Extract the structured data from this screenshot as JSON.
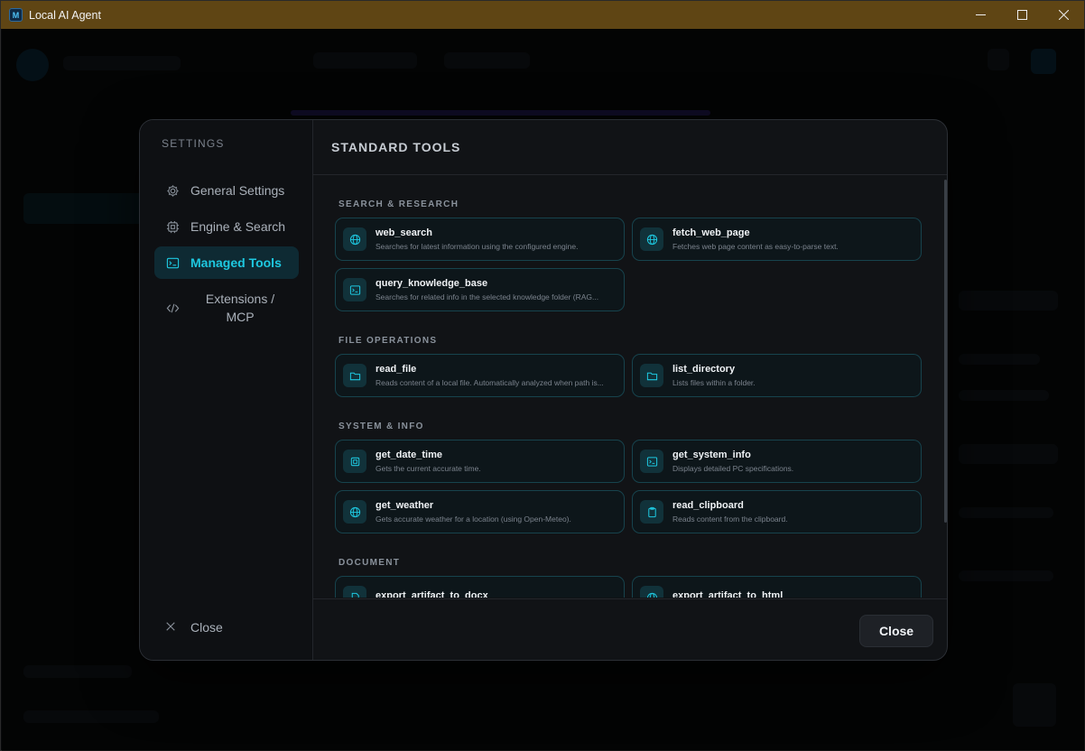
{
  "window": {
    "title": "Local AI Agent",
    "icon_letter": "M"
  },
  "sidebar": {
    "title": "SETTINGS",
    "items": [
      {
        "label": "General Settings",
        "icon": "gear-icon"
      },
      {
        "label": "Engine & Search",
        "icon": "chip-icon"
      },
      {
        "label": "Managed Tools",
        "icon": "terminal-icon"
      },
      {
        "label": "Extensions / MCP",
        "icon": "code-icon"
      }
    ],
    "close_label": "Close"
  },
  "main": {
    "title": "STANDARD TOOLS",
    "sections": [
      {
        "label": "SEARCH & RESEARCH"
      },
      {
        "label": "FILE OPERATIONS"
      },
      {
        "label": "SYSTEM & INFO"
      },
      {
        "label": "DOCUMENT"
      }
    ],
    "tools": {
      "web_search": {
        "name": "web_search",
        "desc": "Searches for latest information using the configured engine.",
        "icon": "globe-icon"
      },
      "fetch_web_page": {
        "name": "fetch_web_page",
        "desc": "Fetches web page content as easy-to-parse text.",
        "icon": "globe-icon"
      },
      "query_knowledge_base": {
        "name": "query_knowledge_base",
        "desc": "Searches for related info in the selected knowledge folder (RAG...",
        "icon": "terminal-icon"
      },
      "read_file": {
        "name": "read_file",
        "desc": "Reads content of a local file. Automatically analyzed when path is...",
        "icon": "folder-icon"
      },
      "list_directory": {
        "name": "list_directory",
        "desc": "Lists files within a folder.",
        "icon": "folder-icon"
      },
      "get_date_time": {
        "name": "get_date_time",
        "desc": "Gets the current accurate time.",
        "icon": "chip-icon"
      },
      "get_system_info": {
        "name": "get_system_info",
        "desc": "Displays detailed PC specifications.",
        "icon": "terminal-icon"
      },
      "get_weather": {
        "name": "get_weather",
        "desc": "Gets accurate weather for a location (using Open-Meteo).",
        "icon": "globe-icon"
      },
      "read_clipboard": {
        "name": "read_clipboard",
        "desc": "Reads content from the clipboard.",
        "icon": "clipboard-icon"
      },
      "export_artifact_to_docx": {
        "name": "export_artifact_to_docx",
        "desc": "",
        "icon": "document-icon"
      },
      "export_artifact_to_html": {
        "name": "export_artifact_to_html",
        "desc": "",
        "icon": "globe-icon"
      }
    }
  },
  "footer": {
    "close_label": "Close"
  },
  "colors": {
    "accent": "#1ec8e0",
    "titlebar": "#5f4514",
    "card_border": "#17434d"
  }
}
